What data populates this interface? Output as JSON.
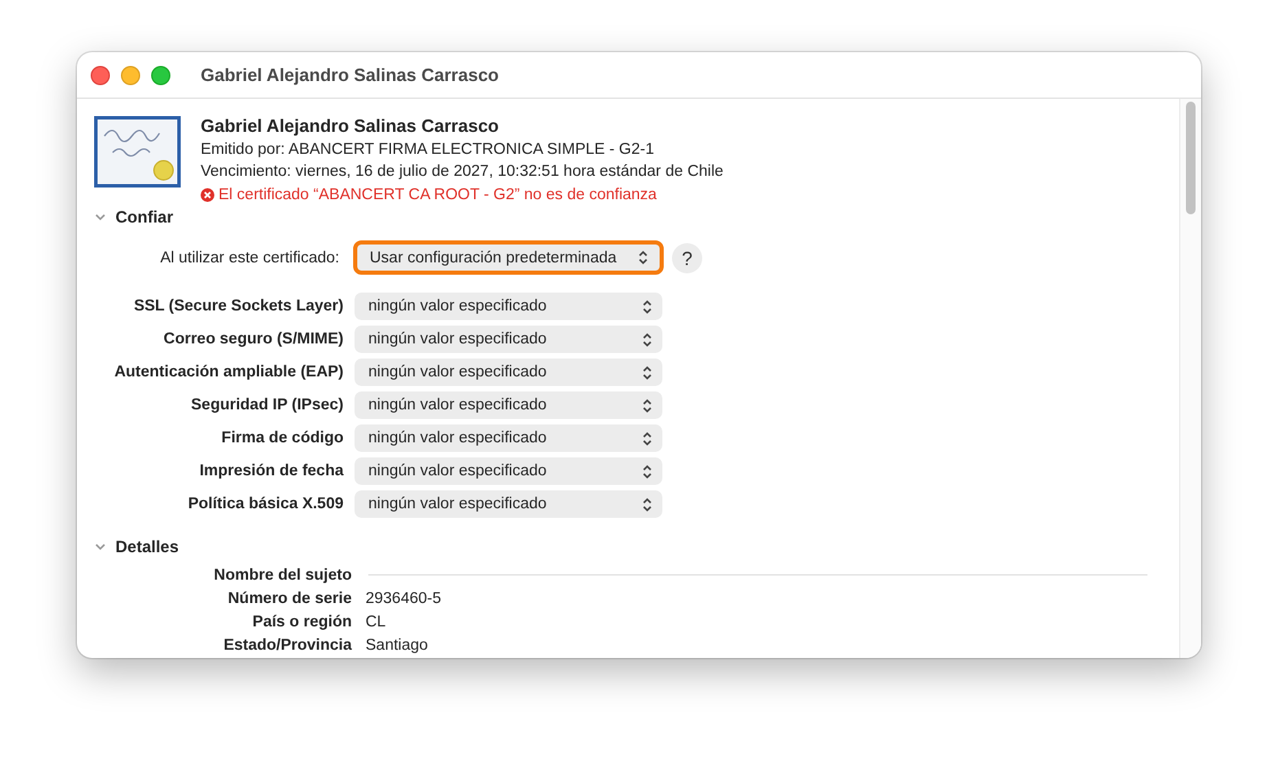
{
  "window": {
    "title": "Gabriel Alejandro Salinas Carrasco"
  },
  "certificate": {
    "name": "Gabriel Alejandro Salinas Carrasco",
    "issuer": "Emitido por: ABANCERT FIRMA ELECTRONICA SIMPLE - G2-1",
    "expiry": "Vencimiento: viernes, 16 de julio de 2027, 10:32:51 hora estándar de Chile",
    "warning": "El certificado “ABANCERT CA ROOT - G2” no es de confianza"
  },
  "trust": {
    "title": "Confiar",
    "expanded": true,
    "main": {
      "label": "Al utilizar este certificado:",
      "value": "Usar configuración predeterminada",
      "focused": true
    },
    "help": "?",
    "policies": [
      {
        "label": "SSL (Secure Sockets Layer)",
        "value": "ningún valor especificado"
      },
      {
        "label": "Correo seguro (S/MIME)",
        "value": "ningún valor especificado"
      },
      {
        "label": "Autenticación ampliable (EAP)",
        "value": "ningún valor especificado"
      },
      {
        "label": "Seguridad IP (IPsec)",
        "value": "ningún valor especificado"
      },
      {
        "label": "Firma de código",
        "value": "ningún valor especificado"
      },
      {
        "label": "Impresión de fecha",
        "value": "ningún valor especificado"
      },
      {
        "label": "Política básica X.509",
        "value": "ningún valor especificado"
      }
    ]
  },
  "details": {
    "title": "Detalles",
    "expanded": true,
    "rows": [
      {
        "kind": "heading",
        "label": "Nombre del sujeto"
      },
      {
        "kind": "field",
        "label": "Número de serie",
        "value": "2936460-5"
      },
      {
        "kind": "field",
        "label": "País o región",
        "value": "CL"
      },
      {
        "kind": "field",
        "label": "Estado/Provincia",
        "value": "Santiago"
      }
    ]
  }
}
